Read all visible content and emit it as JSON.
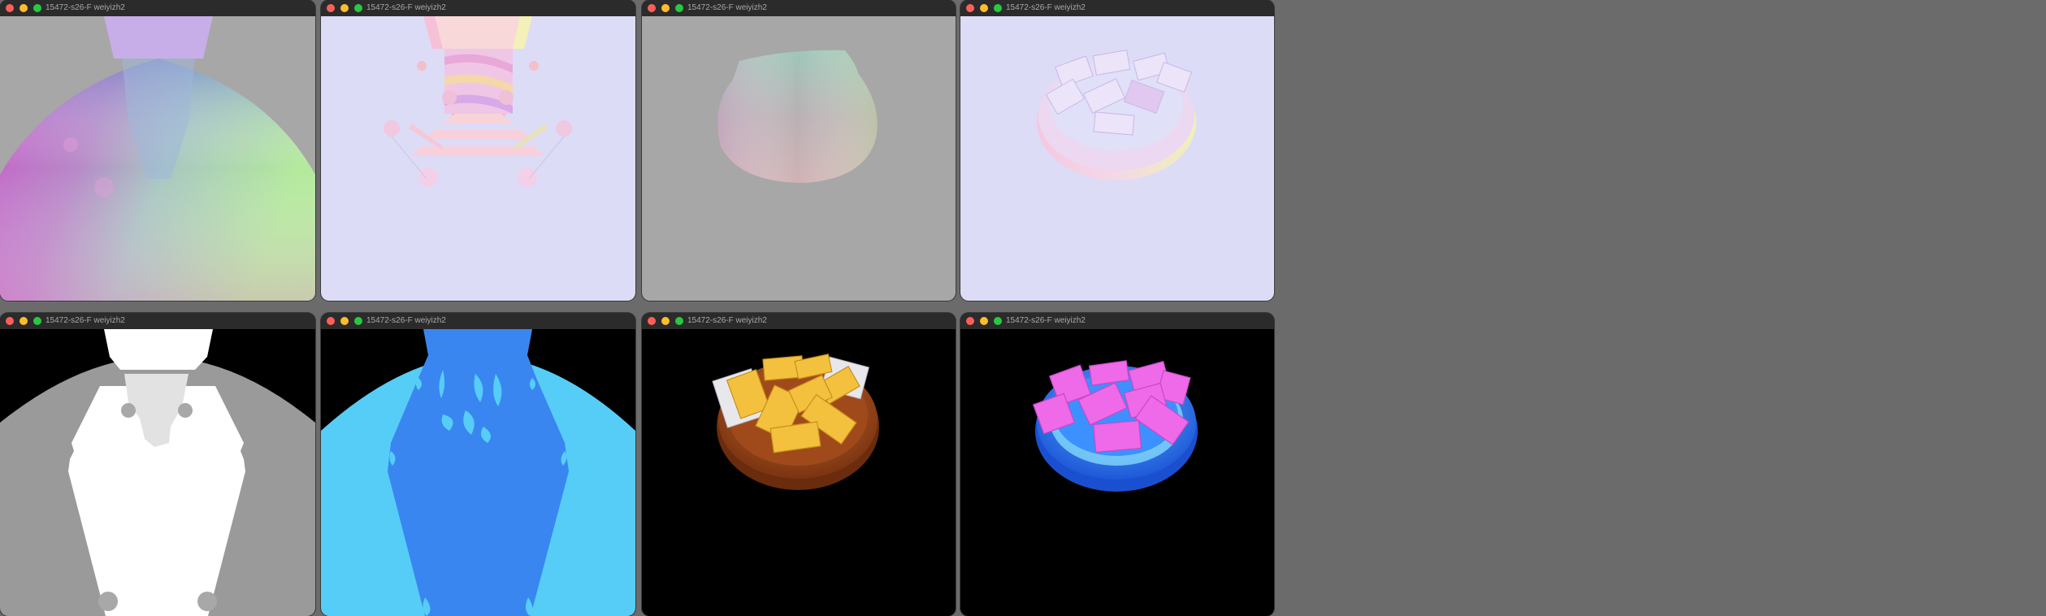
{
  "windows": [
    {
      "id": "normals-world-sphere",
      "title": "15472-s26-F weiyizh2"
    },
    {
      "id": "normals-world-tower",
      "title": "15472-s26-F weiyizh2"
    },
    {
      "id": "normals-blob",
      "title": "15472-s26-F weiyizh2"
    },
    {
      "id": "normals-tray",
      "title": "15472-s26-F weiyizh2"
    },
    {
      "id": "depth-gray",
      "title": "15472-s26-F weiyizh2"
    },
    {
      "id": "material-id-blue",
      "title": "15472-s26-F weiyizh2"
    },
    {
      "id": "shaded-gold-tray",
      "title": "15472-s26-F weiyizh2"
    },
    {
      "id": "shaded-pink-tray",
      "title": "15472-s26-F weiyizh2"
    }
  ],
  "colors": {
    "titlebar": "#2b2b2b",
    "title_text": "#a8a8a8",
    "close": "#ff5f57",
    "minimize": "#febc2e",
    "maximize": "#28c840",
    "normal_bg_gray": "#a7a7a7",
    "normal_bg_lavender": "#dcdcf7",
    "depth_far": "#9a9a9a",
    "depth_near": "#ffffff",
    "id_cyan": "#56cdf7",
    "id_blue": "#3a86f0",
    "gold": "#f4c13e",
    "wood": "#9a4a1e",
    "pink": "#ee6ae8",
    "tray_blue": "#2f7ff0"
  }
}
